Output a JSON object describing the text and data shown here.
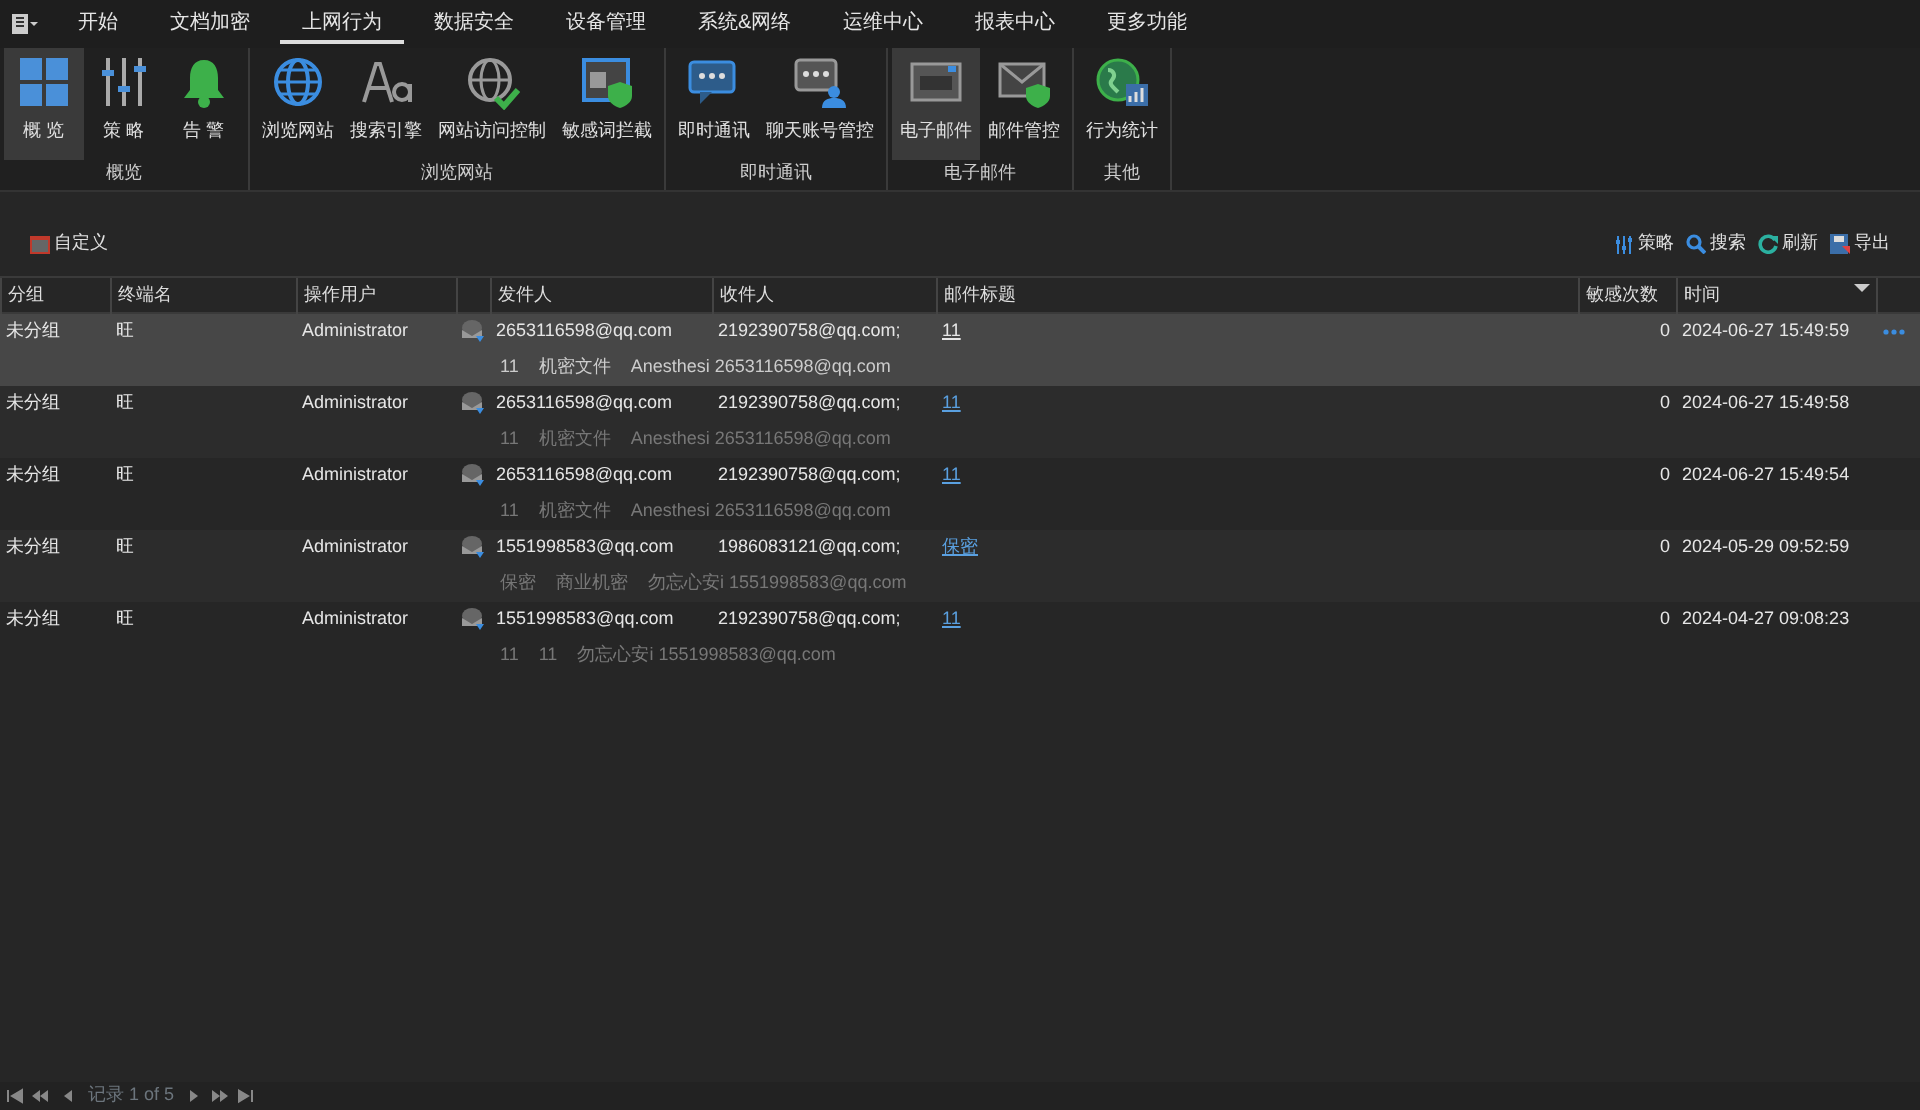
{
  "menu_tabs": [
    {
      "label": "开始",
      "selected": false
    },
    {
      "label": "文档加密",
      "selected": false
    },
    {
      "label": "上网行为",
      "selected": true
    },
    {
      "label": "数据安全",
      "selected": false
    },
    {
      "label": "设备管理",
      "selected": false
    },
    {
      "label": "系统&网络",
      "selected": false
    },
    {
      "label": "运维中心",
      "selected": false
    },
    {
      "label": "报表中心",
      "selected": false
    },
    {
      "label": "更多功能",
      "selected": false
    }
  ],
  "ribbon_groups": [
    {
      "title": "概览",
      "items": [
        {
          "label": "概 览",
          "selected": true
        },
        {
          "label": "策 略",
          "selected": false
        },
        {
          "label": "告 警",
          "selected": false
        }
      ]
    },
    {
      "title": "浏览网站",
      "items": [
        {
          "label": "浏览网站",
          "selected": false
        },
        {
          "label": "搜索引擎",
          "selected": false
        },
        {
          "label": "网站访问控制",
          "selected": false
        },
        {
          "label": "敏感词拦截",
          "selected": false
        }
      ]
    },
    {
      "title": "即时通讯",
      "items": [
        {
          "label": "即时通讯",
          "selected": false
        },
        {
          "label": "聊天账号管控",
          "selected": false
        }
      ]
    },
    {
      "title": "电子邮件",
      "items": [
        {
          "label": "电子邮件",
          "selected": true
        },
        {
          "label": "邮件管控",
          "selected": false
        }
      ]
    },
    {
      "title": "其他",
      "items": [
        {
          "label": "行为统计",
          "selected": false
        }
      ]
    }
  ],
  "toolbar": {
    "customize": "自定义",
    "actions": [
      "策略",
      "搜索",
      "刷新",
      "导出"
    ]
  },
  "table": {
    "columns": [
      "分组",
      "终端名",
      "操作用户",
      "发件人",
      "收件人",
      "邮件标题",
      "敏感次数",
      "时间"
    ],
    "rows": [
      {
        "selected": true,
        "group": "未分组",
        "terminal": "旺",
        "user": "Administrator",
        "sender": "2653116598@qq.com",
        "recipient": "2192390758@qq.com;",
        "subject": "11",
        "count": "0",
        "time": "2024-06-27 15:49:59",
        "detail": [
          "11",
          "机密文件",
          "Anesthesi 2653116598@qq.com"
        ]
      },
      {
        "selected": false,
        "group": "未分组",
        "terminal": "旺",
        "user": "Administrator",
        "sender": "2653116598@qq.com",
        "recipient": "2192390758@qq.com;",
        "subject": "11",
        "count": "0",
        "time": "2024-06-27 15:49:58",
        "detail": [
          "11",
          "机密文件",
          "Anesthesi 2653116598@qq.com"
        ]
      },
      {
        "selected": false,
        "group": "未分组",
        "terminal": "旺",
        "user": "Administrator",
        "sender": "2653116598@qq.com",
        "recipient": "2192390758@qq.com;",
        "subject": "11",
        "count": "0",
        "time": "2024-06-27 15:49:54",
        "detail": [
          "11",
          "机密文件",
          "Anesthesi 2653116598@qq.com"
        ]
      },
      {
        "selected": false,
        "group": "未分组",
        "terminal": "旺",
        "user": "Administrator",
        "sender": "1551998583@qq.com",
        "recipient": "1986083121@qq.com;",
        "subject": "保密",
        "count": "0",
        "time": "2024-05-29 09:52:59",
        "detail": [
          "保密",
          "商业机密",
          "勿忘心安i 1551998583@qq.com"
        ]
      },
      {
        "selected": false,
        "group": "未分组",
        "terminal": "旺",
        "user": "Administrator",
        "sender": "1551998583@qq.com",
        "recipient": "2192390758@qq.com;",
        "subject": "11",
        "count": "0",
        "time": "2024-04-27 09:08:23",
        "detail": [
          "11",
          "11",
          "勿忘心安i 1551998583@qq.com"
        ]
      }
    ]
  },
  "pager": {
    "record": "记录 1 of 5"
  }
}
